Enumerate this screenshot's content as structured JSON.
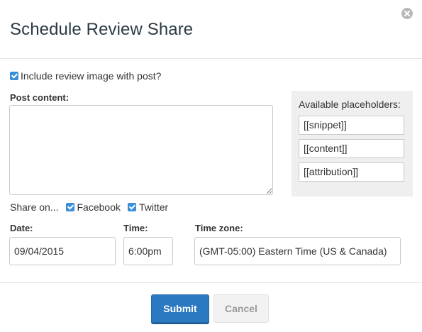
{
  "dialog": {
    "title": "Schedule Review Share"
  },
  "include_image": {
    "label": "Include review image with post?",
    "checked": true
  },
  "post_content": {
    "label": "Post content:",
    "value": ""
  },
  "placeholders": {
    "title": "Available placeholders:",
    "items": [
      "[[snippet]]",
      "[[content]]",
      "[[attribution]]"
    ]
  },
  "share": {
    "label": "Share on...",
    "options": [
      {
        "label": "Facebook",
        "checked": true
      },
      {
        "label": "Twitter",
        "checked": true
      }
    ]
  },
  "date": {
    "label": "Date:",
    "value": "09/04/2015"
  },
  "time": {
    "label": "Time:",
    "value": "6:00pm"
  },
  "timezone": {
    "label": "Time zone:",
    "value": "(GMT-05:00) Eastern Time (US & Canada)"
  },
  "buttons": {
    "submit": "Submit",
    "cancel": "Cancel"
  },
  "colors": {
    "accent": "#2b79c1",
    "checkbox": "#3b8ed8",
    "panel_bg": "#efefef"
  },
  "icons": {
    "close": "close-icon",
    "checkbox": "checkbox-checked-icon"
  }
}
